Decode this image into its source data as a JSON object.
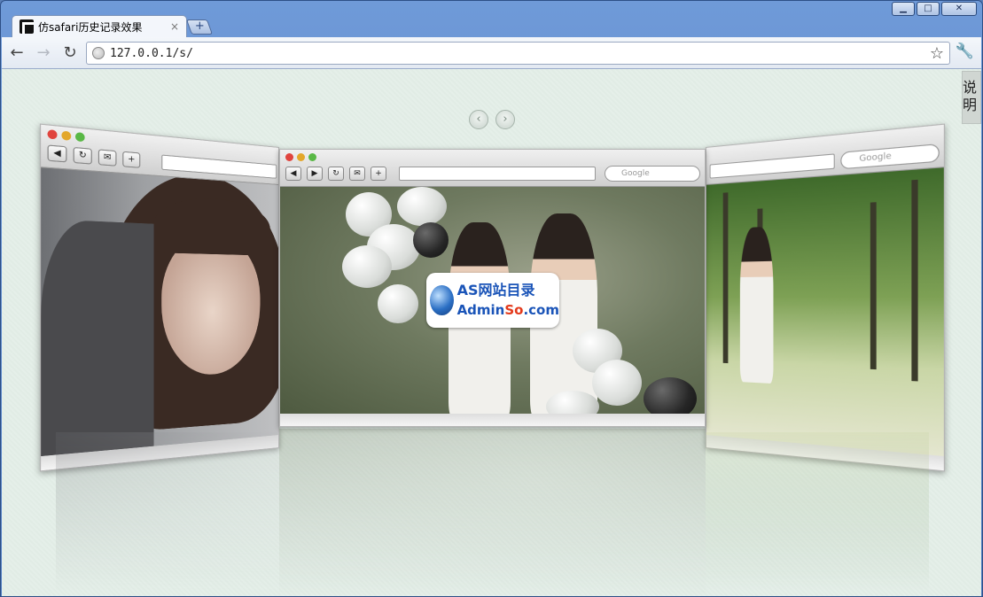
{
  "window": {
    "controls": {
      "minimize": "▁",
      "maximize": "□",
      "close": "✕"
    }
  },
  "tabs": [
    {
      "title": "仿safari历史记录效果",
      "close": "×"
    }
  ],
  "new_tab_label": "+",
  "toolbar": {
    "back": "←",
    "forward": "→",
    "reload": "↻",
    "url": "127.0.0.1/s/",
    "star": "☆",
    "wrench": "🔧"
  },
  "content": {
    "side_tab": "说明",
    "prev_arrow": "‹",
    "next_arrow": "›",
    "cards": {
      "search_placeholder": "Google",
      "mini_buttons": [
        "◀",
        "▶",
        "↻",
        "✉",
        "+"
      ]
    },
    "logo": {
      "line1": "AS网站目录",
      "line2_a": "Admin",
      "line2_b": "So",
      "line2_c": ".com"
    }
  },
  "colors": {
    "content_bg": "#e1ece5",
    "window_frame": "#5a7fb8",
    "logo_blue": "#1a54b8",
    "logo_red": "#e33a1c"
  }
}
